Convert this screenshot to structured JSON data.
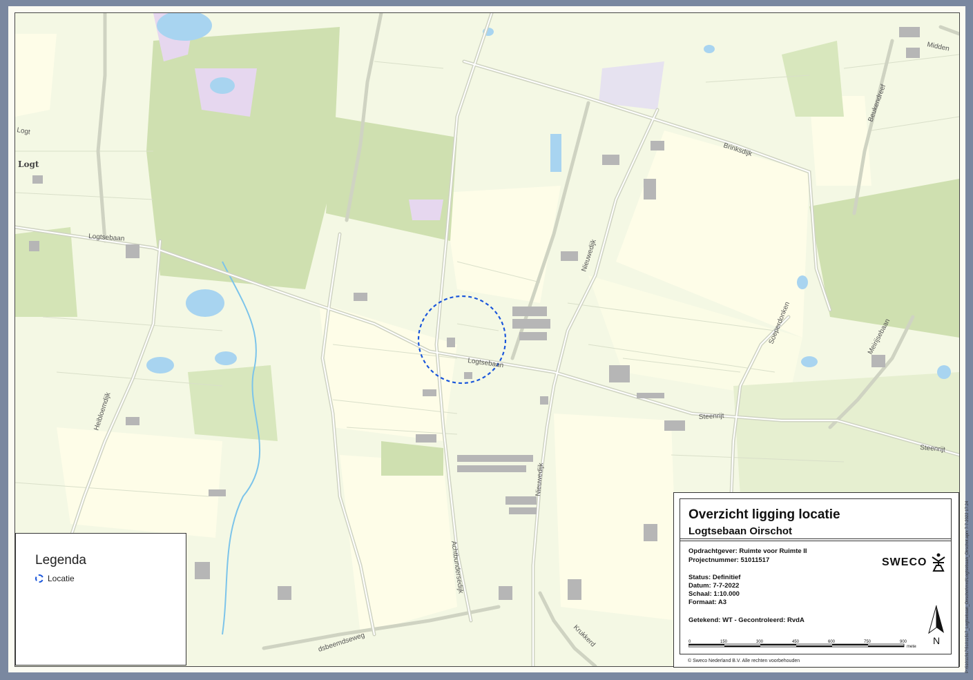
{
  "map": {
    "place_labels": {
      "logt_road": "Logt",
      "logt_place": "Logt"
    },
    "road_labels": {
      "logtsebaan_west": "Logtsebaan",
      "logtsebaan_center": "Logtsebaan",
      "brinksdijk": "Brinksdijk",
      "nieuwedijk_north": "Nieuwedijk",
      "nieuwedijk_south": "Nieuwedijk",
      "soeperdonken": "Soeperdonken",
      "meirijsebaan": "Meirijsebaan",
      "beukendreef": "Beukendreef",
      "steenrijt_center": "Steenrijt",
      "steenrijt_east": "Steenrijt",
      "heibloemdijk": "Heibloemdijk",
      "achtbundersedijk": "Achtbundersedijk",
      "krukkerd": "Krukkerd",
      "dsbeemdseweg": "dsbeemdseweg",
      "middel": "Midden"
    },
    "location_marker_color": "#1a56db"
  },
  "legend": {
    "title": "Legenda",
    "items": [
      {
        "label": "Locatie",
        "symbol": "dashed-circle-icon"
      }
    ]
  },
  "titleblock": {
    "title": "Overzicht ligging locatie",
    "subtitle": "Logtsebaan Oirschot",
    "opdrachtgever": "Opdrachtgever: Ruimte voor Ruimte II",
    "projectnummer": "Projectnummer: 51011517",
    "status": "Status: Definitief",
    "datum": "Datum: 7-7-2022",
    "schaal": "Schaal: 1:10.000",
    "formaat": "Formaat: A3",
    "getekend": "Getekend: WT - Gecontroleerd: RvdA",
    "logo_text": "SWECO",
    "north_label": "N",
    "scale_ticks": [
      "0",
      "150",
      "300",
      "450",
      "600",
      "750",
      "900"
    ],
    "scale_unit": "meter",
    "copyright": "© Sweco Nederland B.V. Alle rechten voorbehouden"
  },
  "side_text": "P:\\51011517\\51011517_Logtsebaan_Oirschot\\mxd\\Logtsebaan_Oirschot.aprx 7-7-2022 17:24"
}
